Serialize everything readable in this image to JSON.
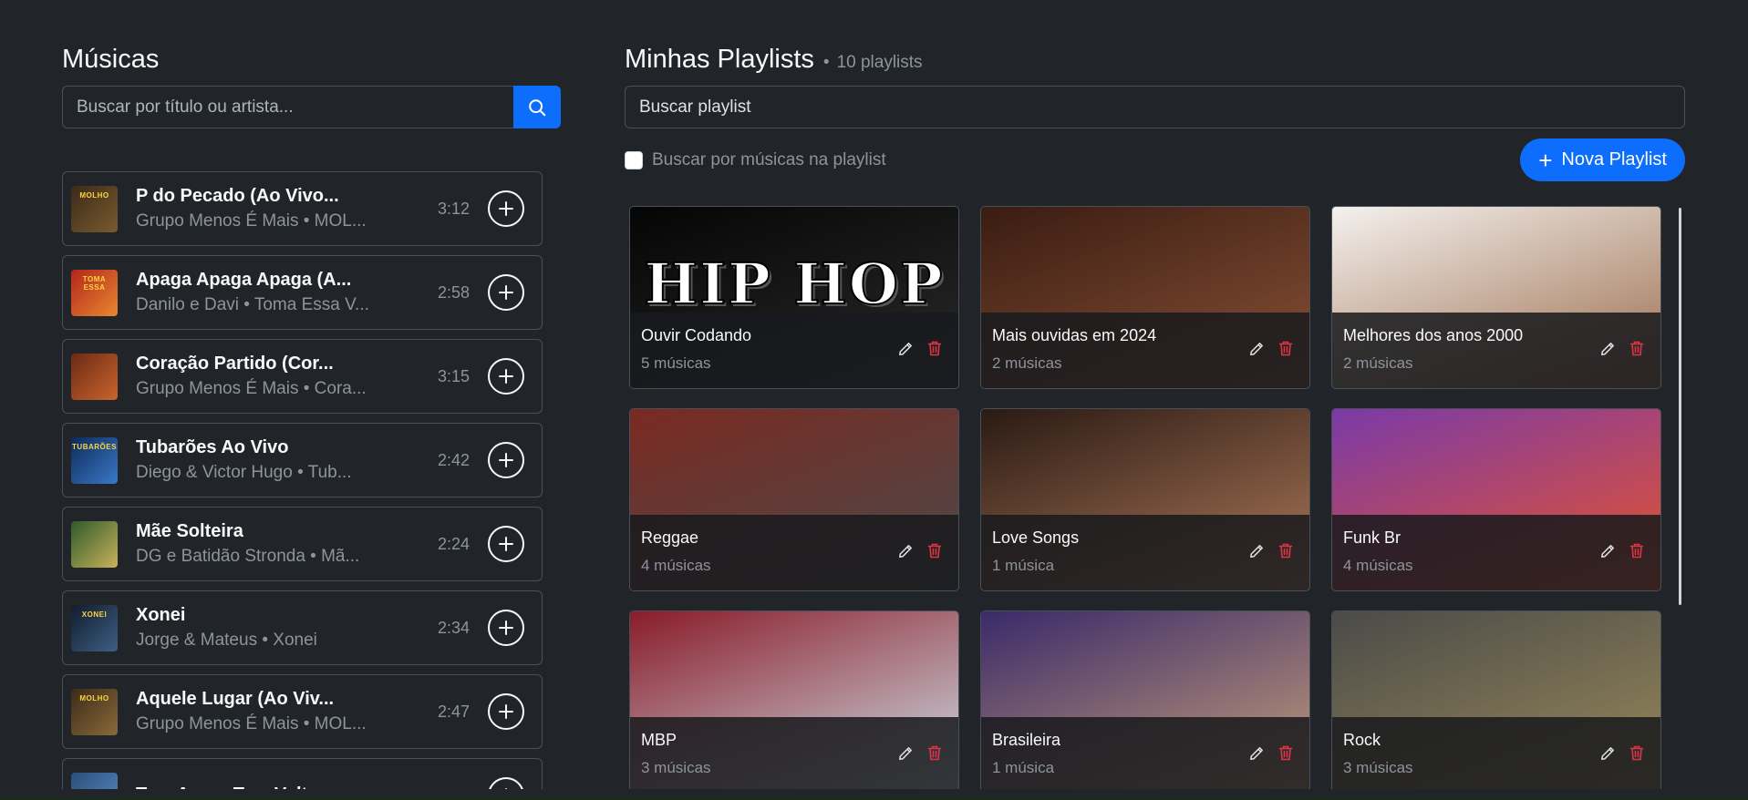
{
  "songs_panel": {
    "title": "Músicas",
    "search_placeholder": "Buscar por título ou artista...",
    "songs": [
      {
        "title": "P do Pecado (Ao Vivo...",
        "subtitle": "Grupo Menos É Mais • MOL...",
        "duration": "3:12",
        "cover_caption": "MOLHO",
        "cover_colors": [
          "#3b2b1a",
          "#7a5a2e"
        ]
      },
      {
        "title": "Apaga Apaga Apaga (A...",
        "subtitle": "Danilo e Davi • Toma Essa V...",
        "duration": "2:58",
        "cover_caption": "TOMA ESSA",
        "cover_colors": [
          "#b3261e",
          "#e9872f"
        ]
      },
      {
        "title": "Coração Partido (Cor...",
        "subtitle": "Grupo Menos É Mais • Cora...",
        "duration": "3:15",
        "cover_caption": "",
        "cover_colors": [
          "#6b2a14",
          "#c9652d"
        ]
      },
      {
        "title": "Tubarões Ao Vivo",
        "subtitle": "Diego & Victor Hugo • Tub...",
        "duration": "2:42",
        "cover_caption": "TUBARÕES",
        "cover_colors": [
          "#0d2a5a",
          "#3a78c8"
        ]
      },
      {
        "title": "Mãe Solteira",
        "subtitle": "DG e Batidão Stronda • Mã...",
        "duration": "2:24",
        "cover_caption": "",
        "cover_colors": [
          "#2d5a2a",
          "#c9b25a"
        ]
      },
      {
        "title": "Xonei",
        "subtitle": "Jorge & Mateus • Xonei",
        "duration": "2:34",
        "cover_caption": "XONEI",
        "cover_colors": [
          "#111c2b",
          "#3d5f86"
        ]
      },
      {
        "title": "Aquele Lugar (Ao Viv...",
        "subtitle": "Grupo Menos É Mais • MOL...",
        "duration": "2:47",
        "cover_caption": "MOLHO",
        "cover_colors": [
          "#3b2b1a",
          "#8a6a3a"
        ]
      },
      {
        "title": "Tem Amor, Tem Volta",
        "subtitle": "",
        "duration": "",
        "cover_caption": "",
        "cover_colors": [
          "#2a4f7a",
          "#5b8fc8"
        ]
      }
    ]
  },
  "playlists_panel": {
    "title": "Minhas Playlists",
    "count_separator": "•",
    "count_label": "10 playlists",
    "search_placeholder": "Buscar playlist",
    "checkbox_label": "Buscar por músicas na playlist",
    "new_button_label": "Nova Playlist",
    "playlists": [
      {
        "name": "Ouvir Codando",
        "count": "5 músicas",
        "art_text": "HIP HOP",
        "art_colors": [
          "#050505",
          "#2a2a2a"
        ]
      },
      {
        "name": "Mais ouvidas em 2024",
        "count": "2 músicas",
        "art_text": "",
        "art_colors": [
          "#3a1c12",
          "#8a5236"
        ]
      },
      {
        "name": "Melhores dos anos 2000",
        "count": "2 músicas",
        "art_text": "",
        "art_colors": [
          "#f4f1ee",
          "#9a6a4a"
        ]
      },
      {
        "name": "Reggae",
        "count": "4 músicas",
        "art_text": "",
        "art_colors": [
          "#7a2a22",
          "#4a4a4a"
        ]
      },
      {
        "name": "Love Songs",
        "count": "1 música",
        "art_text": "",
        "art_colors": [
          "#2a1a14",
          "#b07a5a"
        ]
      },
      {
        "name": "Funk Br",
        "count": "4 músicas",
        "art_text": "",
        "art_colors": [
          "#7a3aa8",
          "#e8542a"
        ]
      },
      {
        "name": "MBP",
        "count": "3 músicas",
        "art_text": "",
        "art_colors": [
          "#8a1c2a",
          "#cfe3ea"
        ]
      },
      {
        "name": "Brasileira",
        "count": "1 música",
        "art_text": "",
        "art_colors": [
          "#3a2a6a",
          "#c8a07a"
        ]
      },
      {
        "name": "Rock",
        "count": "3 músicas",
        "art_text": "",
        "art_colors": [
          "#4a4a48",
          "#9a8a5a"
        ]
      }
    ]
  },
  "colors": {
    "background": "#212529",
    "accent": "#0d6efd",
    "danger": "#dc3545",
    "border": "#495057"
  }
}
